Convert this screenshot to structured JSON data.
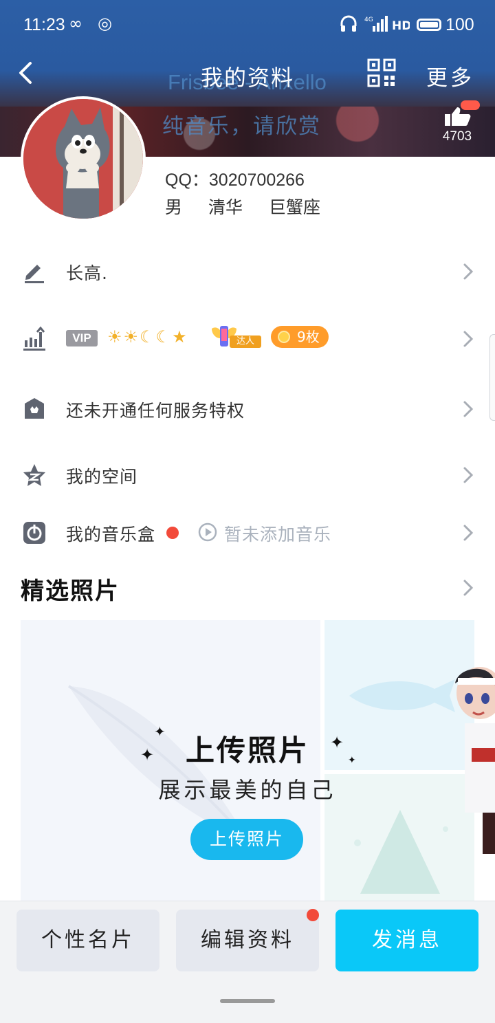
{
  "status_bar": {
    "time": "11:23",
    "battery": "100"
  },
  "nav": {
    "title": "我的资料",
    "more": "更多"
  },
  "header": {
    "music_title": "Frisbee - Anxello",
    "music_caption": "纯音乐，请欣赏",
    "likes": "4703"
  },
  "profile": {
    "qq": "QQ：3020700266",
    "gender": "男",
    "school": "清华",
    "zodiac": "巨蟹座"
  },
  "rows": {
    "signature": "长高.",
    "vip_badge": "VIP",
    "daren_tag": "达人",
    "medal": "9枚",
    "service": "还未开通任何服务特权",
    "space": "我的空间",
    "musicbox": "我的音乐盒",
    "musicbox_hint": "暂未添加音乐"
  },
  "photos": {
    "section_title": "精选照片",
    "upload_title": "上传照片",
    "upload_sub": "展示最美的自己",
    "upload_button": "上传照片"
  },
  "bottom": {
    "card": "个性名片",
    "edit": "编辑资料",
    "message": "发消息"
  },
  "colors": {
    "header_blue": "#2c5fa6",
    "accent_cyan": "#0ac8f8",
    "upload_blue": "#19b8ee",
    "badge_red": "#f24a3a",
    "medal_orange": "#ff9c2a"
  },
  "icons": [
    "back-icon",
    "qr-code-icon",
    "like-icon",
    "pen-icon",
    "level-chart-icon",
    "crown-shield-icon",
    "qzone-star-icon",
    "music-box-icon",
    "play-icon",
    "chevron-right-icon"
  ]
}
